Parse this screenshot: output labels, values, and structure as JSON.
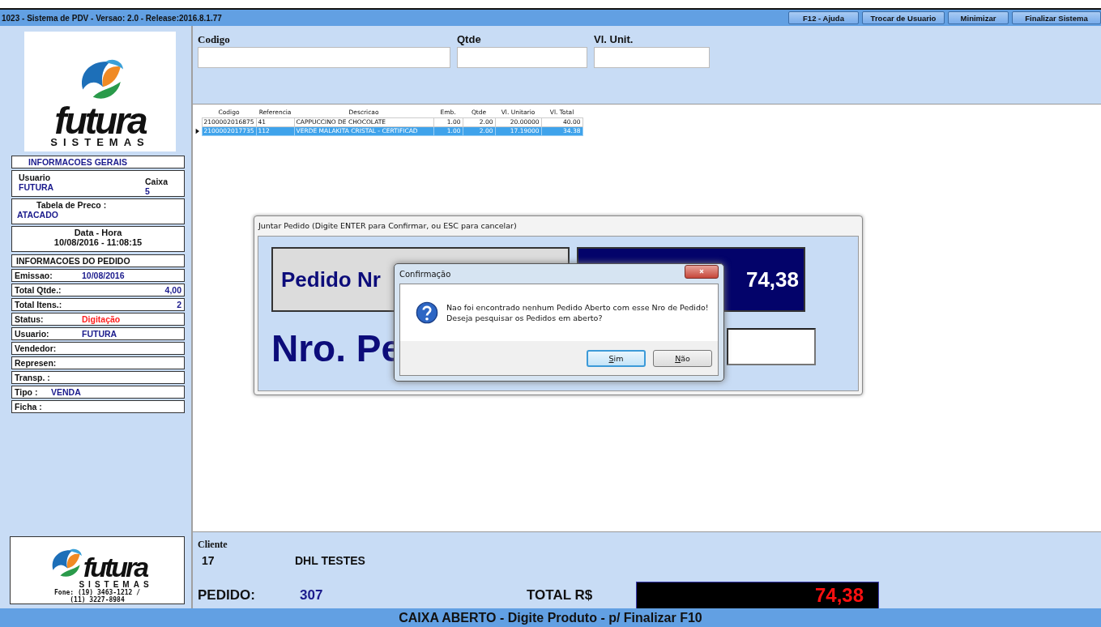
{
  "window": {
    "title": "1023 - Sistema de PDV - Versao: 2.0 - Release:2016.8.1.77",
    "buttons": [
      "F12 - Ajuda",
      "Trocar de Usuario",
      "Minimizar",
      "Finalizar Sistema"
    ]
  },
  "logo": {
    "name": "futura",
    "tagline": "SISTEMAS"
  },
  "general_info": {
    "header": "INFORMACOES GERAIS",
    "user": {
      "label": "Usuario",
      "value": "FUTURA",
      "register_label": "Caixa",
      "register_value": "5"
    },
    "price_table": {
      "label": "Tabela de Preco :",
      "value": "ATACADO"
    },
    "datetime": {
      "label": "Data - Hora",
      "value": "10/08/2016 - 11:08:15"
    }
  },
  "order_info": {
    "header": "INFORMACOES DO PEDIDO",
    "fields": [
      {
        "label": "Emissao:",
        "value": "10/08/2016",
        "kind": "inline",
        "color": "#1a1a8c"
      },
      {
        "label": "Total Qtde.:",
        "value": "4,00",
        "kind": "right",
        "color": "#1a1a8c"
      },
      {
        "label": "Total Itens.:",
        "value": "2",
        "kind": "right",
        "color": "#1a1a8c"
      },
      {
        "label": "Status:",
        "value": "Digitação",
        "kind": "inline",
        "color": "#ff2020"
      },
      {
        "label": "Usuario:",
        "value": "FUTURA",
        "kind": "inline",
        "color": "#1a1a8c"
      },
      {
        "label": "Vendedor:",
        "kind": "inline"
      },
      {
        "label": "Represen:",
        "kind": "inline"
      },
      {
        "label": "Transp. :",
        "kind": "inline"
      },
      {
        "label": "Tipo :",
        "value": "VENDA",
        "kind": "short",
        "color": "#1a1a8c"
      },
      {
        "label": "Ficha :",
        "kind": "inline"
      }
    ]
  },
  "entry": {
    "fields": [
      {
        "label": "Codigo",
        "kind": "wide"
      },
      {
        "label": "Qtde",
        "kind": "mid"
      },
      {
        "label": "Vl. Unit.",
        "kind": "mid"
      }
    ]
  },
  "table": {
    "columns": [
      "Codigo",
      "Referencia",
      "Descricao",
      "Emb.",
      "Qtde",
      "Vl. Unitario",
      "Vl. Total"
    ],
    "rows": [
      {
        "cells": [
          "2100002016875",
          "41",
          "CAPPUCCINO DE CHOCOLATE",
          "1.00",
          "2.00",
          "20.00000",
          "40.00"
        ],
        "selected": false
      },
      {
        "cells": [
          "2100002017735",
          "112",
          "VERDE MALAKITA CRISTAL - CERTIFICAD",
          "1.00",
          "2.00",
          "17.19000",
          "34.38"
        ],
        "selected": true
      }
    ]
  },
  "merge_dialog": {
    "title": "Juntar Pedido (Digite ENTER para Confirmar, ou ESC para cancelar)",
    "order_label": "Pedido Nr",
    "total_value": "74,38",
    "number_label": "Nro. Pe"
  },
  "confirm_dialog": {
    "title": "Confirmação",
    "message": [
      "Nao foi encontrado nenhum Pedido Aberto com esse Nro de Pedido!",
      "Deseja pesquisar os Pedidos em aberto?"
    ],
    "buttons": [
      {
        "label": "Sim",
        "selected": true
      },
      {
        "label": "Não",
        "selected": false
      }
    ]
  },
  "footer": {
    "logo_name": "futura",
    "logo_tagline": "SISTEMAS",
    "phone": [
      "Fone: (19) 3463-1212 /",
      "(11) 3227-8984"
    ],
    "client_label": "Cliente",
    "client_code": "17",
    "client_name": "DHL TESTES",
    "order_label": "PEDIDO:",
    "order_number": "307",
    "total_label": "TOTAL R$",
    "total_value": "74,38"
  },
  "status_bar": "CAIXA ABERTO - Digite Produto - p/ Finalizar F10"
}
